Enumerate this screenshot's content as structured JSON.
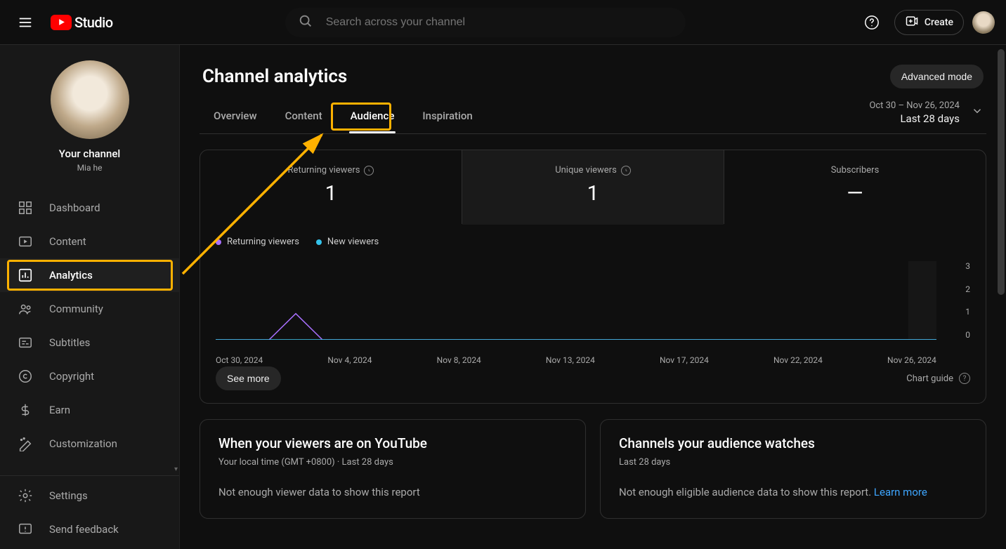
{
  "app": {
    "logo_text": "Studio"
  },
  "search": {
    "placeholder": "Search across your channel"
  },
  "header_actions": {
    "create_label": "Create"
  },
  "sidebar": {
    "channel_title": "Your channel",
    "channel_name": "Mia he",
    "items": [
      {
        "label": "Dashboard"
      },
      {
        "label": "Content"
      },
      {
        "label": "Analytics"
      },
      {
        "label": "Community"
      },
      {
        "label": "Subtitles"
      },
      {
        "label": "Copyright"
      },
      {
        "label": "Earn"
      },
      {
        "label": "Customization"
      }
    ],
    "bottom_items": [
      {
        "label": "Settings"
      },
      {
        "label": "Send feedback"
      }
    ]
  },
  "page": {
    "title": "Channel analytics",
    "advanced_mode": "Advanced mode",
    "tabs": [
      {
        "label": "Overview"
      },
      {
        "label": "Content"
      },
      {
        "label": "Audience"
      },
      {
        "label": "Inspiration"
      }
    ],
    "date_range_sub": "Oct 30 – Nov 26, 2024",
    "date_range_main": "Last 28 days"
  },
  "metrics": {
    "tabs": [
      {
        "label": "Returning viewers",
        "value": "1",
        "has_info": true
      },
      {
        "label": "Unique viewers",
        "value": "1",
        "has_info": true
      },
      {
        "label": "Subscribers",
        "value": "—",
        "has_info": false
      }
    ],
    "legend": [
      {
        "label": "Returning viewers",
        "color": "#a970ff"
      },
      {
        "label": "New viewers",
        "color": "#34c3eb"
      }
    ],
    "see_more": "See more",
    "chart_guide": "Chart guide"
  },
  "chart_data": {
    "type": "line",
    "xlabel": "",
    "ylabel": "",
    "ylim": [
      0,
      3
    ],
    "y_ticks": [
      0,
      1,
      2,
      3
    ],
    "x_ticks": [
      "Oct 30, 2024",
      "Nov 4, 2024",
      "Nov 8, 2024",
      "Nov 13, 2024",
      "Nov 17, 2024",
      "Nov 22, 2024",
      "Nov 26, 2024"
    ],
    "series": [
      {
        "name": "Returning viewers",
        "color": "#a970ff",
        "x": [
          "Oct 30",
          "Oct 31",
          "Nov 1",
          "Nov 2",
          "Nov 3",
          "Nov 4",
          "Nov 5",
          "Nov 6",
          "Nov 7",
          "Nov 8",
          "Nov 9",
          "Nov 10",
          "Nov 11",
          "Nov 12",
          "Nov 13",
          "Nov 14",
          "Nov 15",
          "Nov 16",
          "Nov 17",
          "Nov 18",
          "Nov 19",
          "Nov 20",
          "Nov 21",
          "Nov 22",
          "Nov 23",
          "Nov 24",
          "Nov 25",
          "Nov 26"
        ],
        "values": [
          0,
          0,
          0,
          1,
          0,
          0,
          0,
          0,
          0,
          0,
          0,
          0,
          0,
          0,
          0,
          0,
          0,
          0,
          0,
          0,
          0,
          0,
          0,
          0,
          0,
          0,
          0,
          0
        ]
      },
      {
        "name": "New viewers",
        "color": "#34c3eb",
        "x": [
          "Oct 30",
          "Oct 31",
          "Nov 1",
          "Nov 2",
          "Nov 3",
          "Nov 4",
          "Nov 5",
          "Nov 6",
          "Nov 7",
          "Nov 8",
          "Nov 9",
          "Nov 10",
          "Nov 11",
          "Nov 12",
          "Nov 13",
          "Nov 14",
          "Nov 15",
          "Nov 16",
          "Nov 17",
          "Nov 18",
          "Nov 19",
          "Nov 20",
          "Nov 21",
          "Nov 22",
          "Nov 23",
          "Nov 24",
          "Nov 25",
          "Nov 26"
        ],
        "values": [
          0,
          0,
          0,
          0,
          0,
          0,
          0,
          0,
          0,
          0,
          0,
          0,
          0,
          0,
          0,
          0,
          0,
          0,
          0,
          0,
          0,
          0,
          0,
          0,
          0,
          0,
          0,
          0
        ]
      }
    ]
  },
  "cards": {
    "left": {
      "title": "When your viewers are on YouTube",
      "sub": "Your local time (GMT +0800) · Last 28 days",
      "body": "Not enough viewer data to show this report"
    },
    "right": {
      "title": "Channels your audience watches",
      "sub": "Last 28 days",
      "body_prefix": "Not enough eligible audience data to show this report. ",
      "link": "Learn more"
    }
  }
}
